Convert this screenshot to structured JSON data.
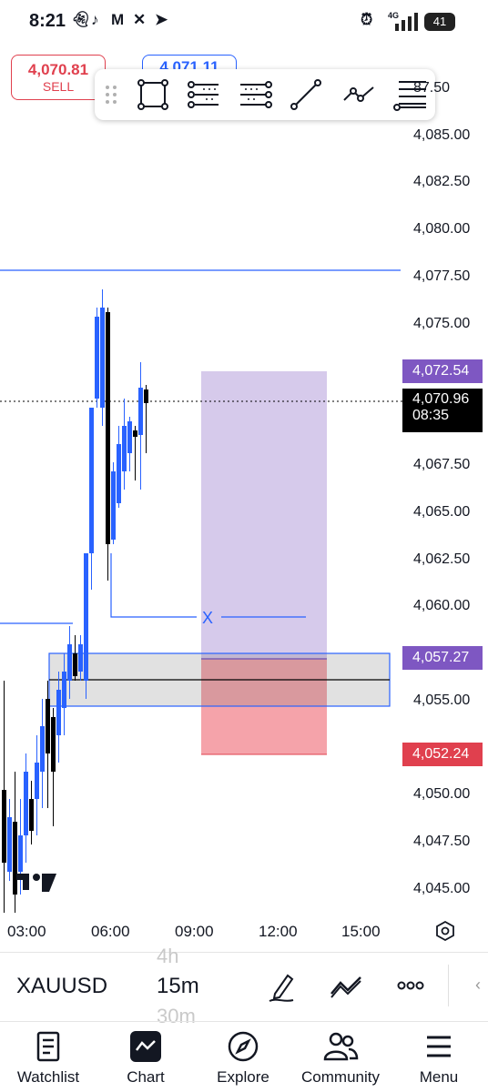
{
  "status_bar": {
    "time": "8:21",
    "network": "4G",
    "battery": "41",
    "app_icons": [
      "snapchat-icon",
      "tiktok-icon",
      "gmail-icon",
      "x-icon",
      "telegram-icon"
    ]
  },
  "order": {
    "sell_price": "4,070.81",
    "sell_label": "SELL",
    "buy_price": "4,071.11"
  },
  "drawing_toolbar": {
    "tools": [
      "drag-handle-icon",
      "rectangle-icon",
      "long-position-icon",
      "short-position-icon",
      "trend-line-icon",
      "path-icon",
      "fib-retracement-icon"
    ]
  },
  "price_axis": {
    "ticks": [
      "87.50",
      "4,085.00",
      "4,082.50",
      "4,080.00",
      "4,077.50",
      "4,075.00",
      "4,067.50",
      "4,065.00",
      "4,062.50",
      "4,060.00",
      "4,055.00",
      "4,050.00",
      "4,047.50",
      "4,045.00"
    ],
    "target_label": "4,072.54",
    "current_price": "4,070.96",
    "countdown": "08:35",
    "entry_label": "4,057.27",
    "stop_label": "4,052.24",
    "colors": {
      "target": "#7e57c2",
      "stop": "#e0404e",
      "current": "#000000",
      "entry": "#7e57c2"
    }
  },
  "chart": {
    "marker": "X",
    "watermark": "TradingView",
    "colors": {
      "up": "#2962ff",
      "down": "#000000",
      "profit_zone": "#d1c4e9",
      "loss_zone": "#f5a3aa"
    }
  },
  "time_axis": {
    "ticks": [
      "03:00",
      "06:00",
      "09:00",
      "12:00",
      "15:00"
    ]
  },
  "symbol_bar": {
    "symbol": "XAUUSD",
    "timeframe": "15m",
    "timeframe_above": "4h",
    "timeframe_below": "30m"
  },
  "nav": {
    "items": [
      {
        "label": "Watchlist",
        "icon": "watchlist-icon"
      },
      {
        "label": "Chart",
        "icon": "chart-icon"
      },
      {
        "label": "Explore",
        "icon": "compass-icon"
      },
      {
        "label": "Community",
        "icon": "community-icon"
      },
      {
        "label": "Menu",
        "icon": "menu-icon"
      }
    ]
  }
}
